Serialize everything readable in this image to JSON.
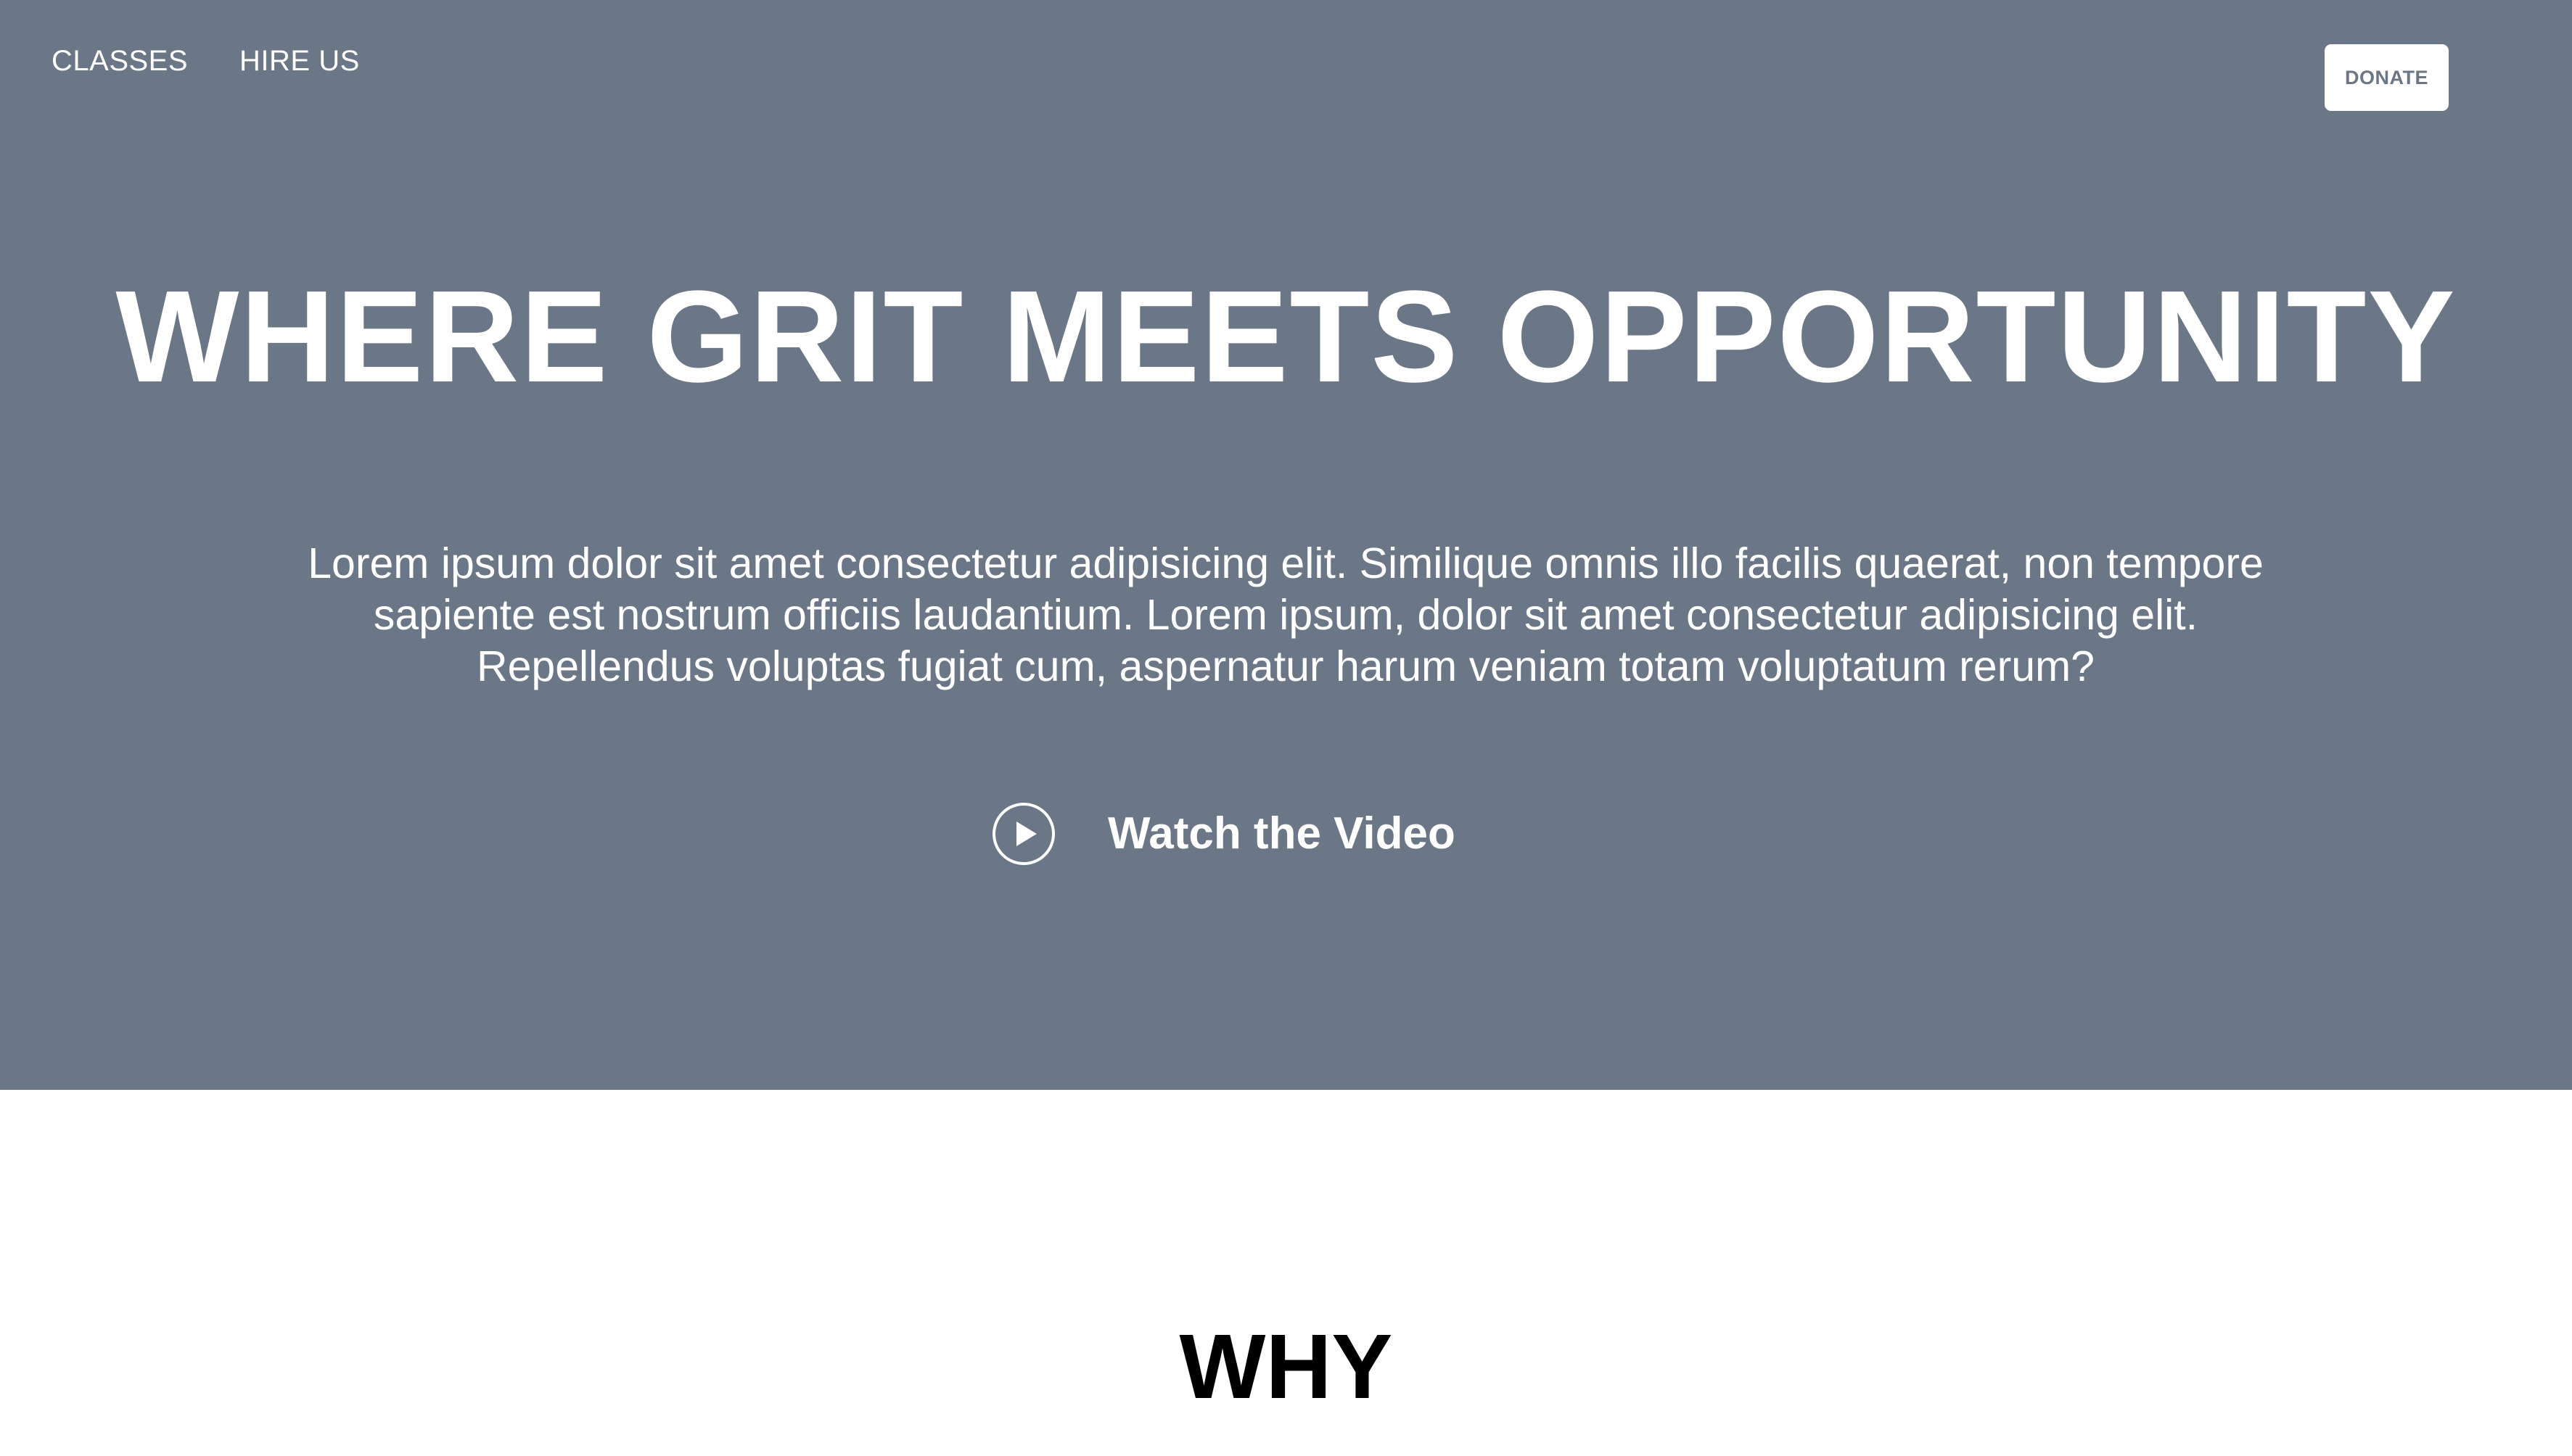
{
  "nav": {
    "items": [
      {
        "label": "CLASSES"
      },
      {
        "label": "HIRE US"
      }
    ],
    "donate_label": "DONATE"
  },
  "hero": {
    "title": "WHERE GRIT MEETS OPPORTUNITY",
    "description": "Lorem ipsum dolor sit amet consectetur adipisicing elit. Similique omnis illo facilis quaerat, non tempore sapiente est nostrum officiis laudantium. Lorem ipsum, dolor sit amet consectetur adipisicing elit. Repellendus voluptas fugiat cum, aspernatur harum veniam totam voluptatum rerum?",
    "video_label": "Watch the Video",
    "video_icon": "play-circle-icon",
    "background_color": "#6b7686"
  },
  "why": {
    "title": "WHY"
  }
}
